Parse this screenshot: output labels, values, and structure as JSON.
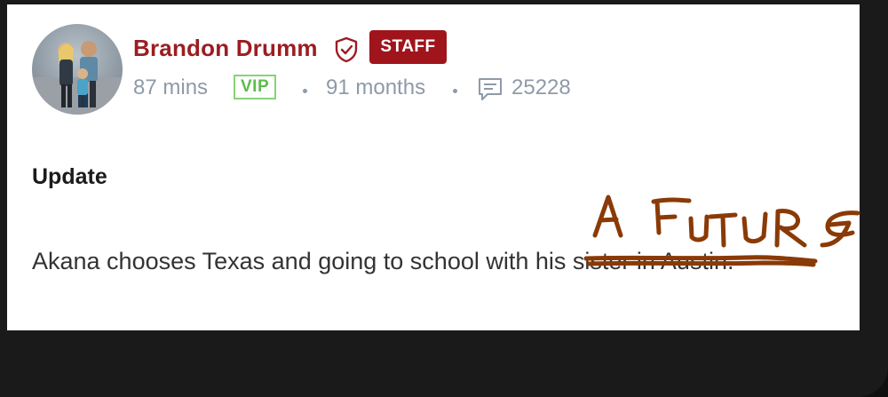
{
  "author": {
    "name": "Brandon Drumm",
    "badge": "STAFF",
    "verified_icon": "shield-check-icon"
  },
  "meta": {
    "time_ago": "87 mins",
    "membership": "VIP",
    "tenure": "91 months",
    "post_count_icon": "comment-icon",
    "post_count": "25228"
  },
  "post": {
    "title": "Update",
    "text_before_strike": "Akana chooses Texas and going to school with",
    "struck_text": " his sister in Austin",
    "text_after_strike": "."
  },
  "handwriting": {
    "text": "A FUTURE",
    "color": "#8a3a06"
  },
  "colors": {
    "name": "#9b1d22",
    "staff_badge": "#a0141b",
    "vip": "#5cbd4a",
    "meta": "#8e9aa8"
  }
}
